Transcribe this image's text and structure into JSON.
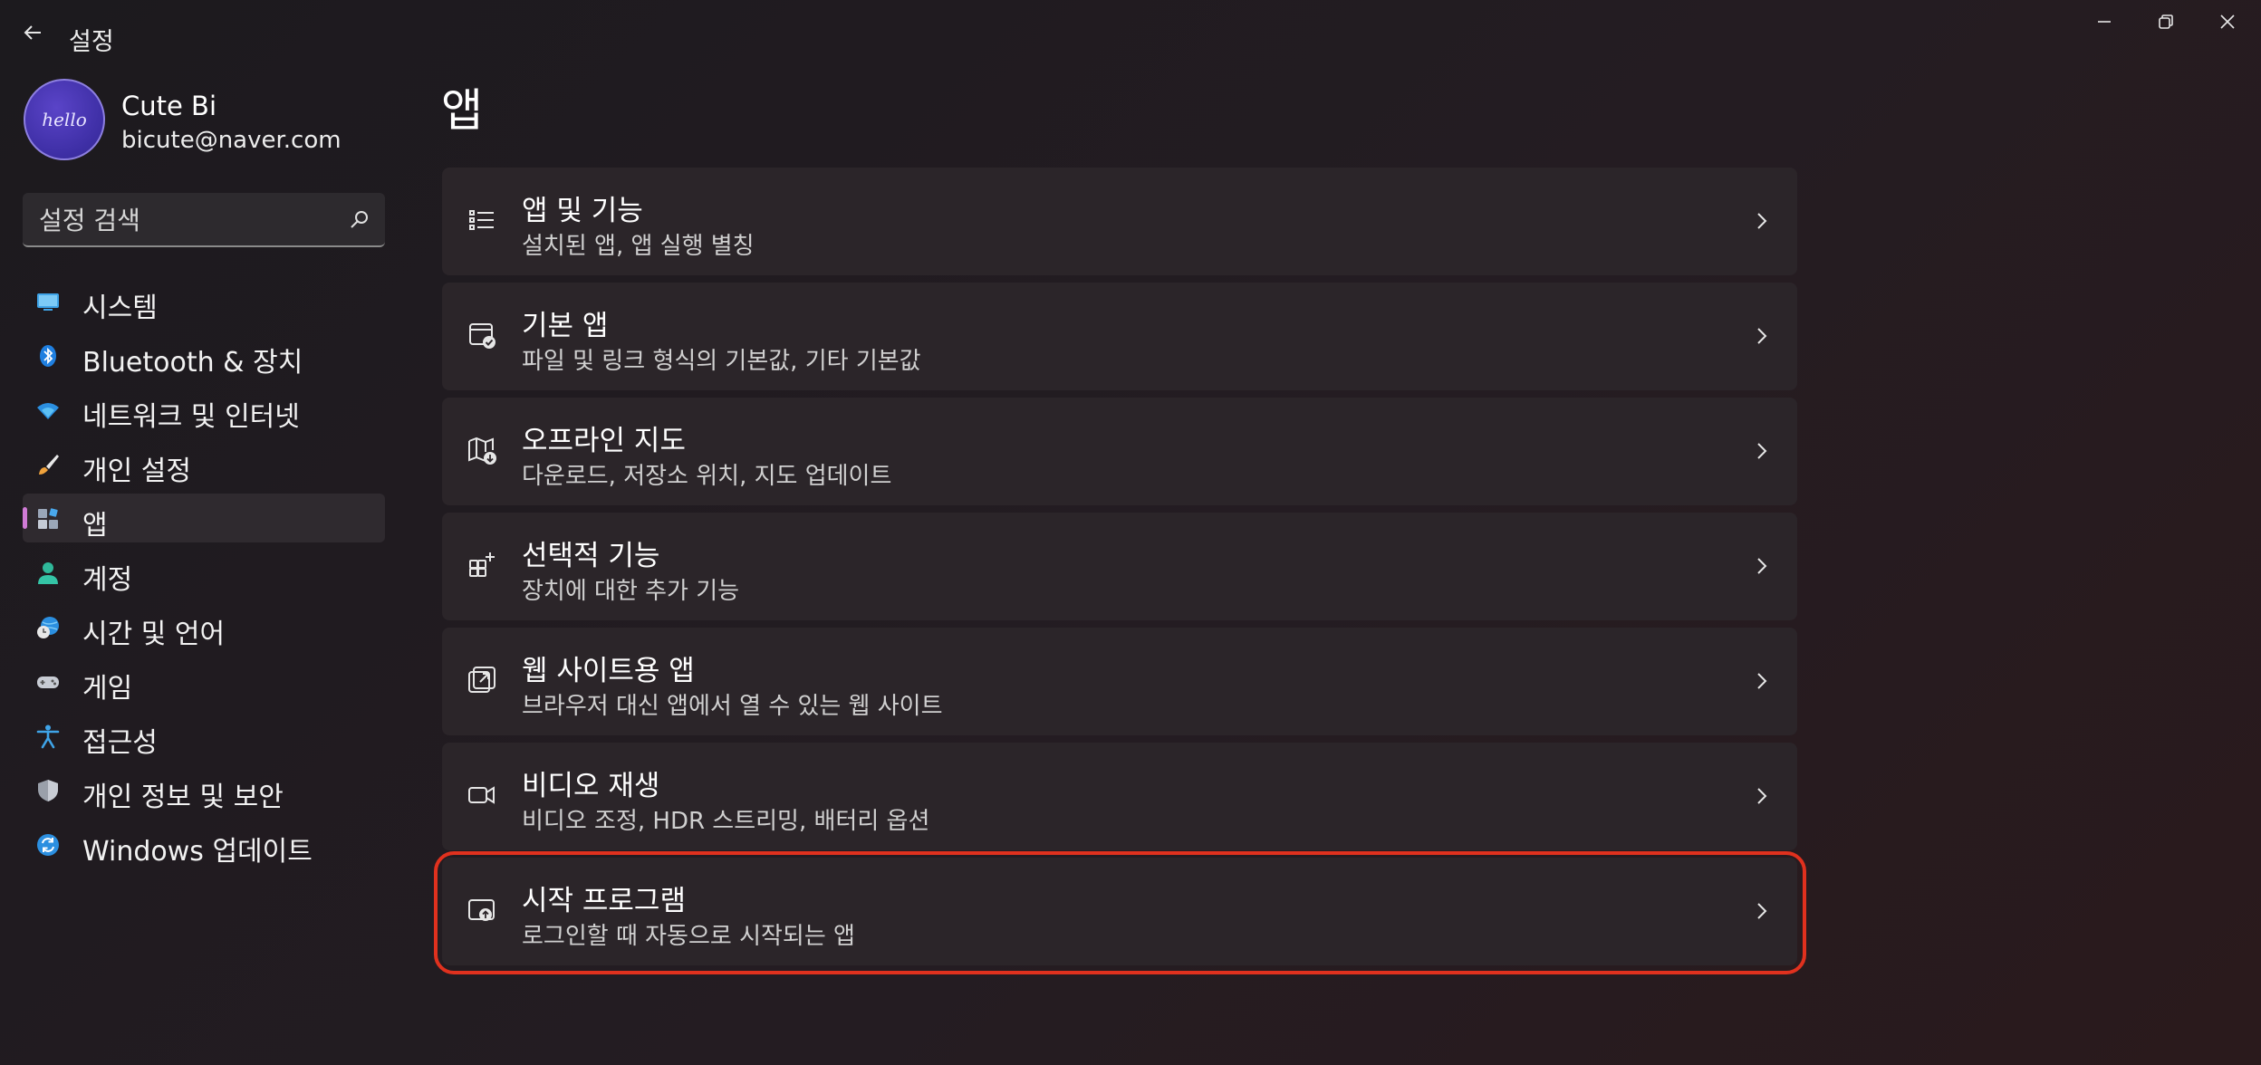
{
  "window": {
    "title": "설정"
  },
  "profile": {
    "name": "Cute Bi",
    "email": "bicute@naver.com",
    "avatar_text": "hello"
  },
  "search": {
    "placeholder": "설정 검색"
  },
  "nav": {
    "items": [
      {
        "label": "시스템",
        "icon": "monitor-icon"
      },
      {
        "label": "Bluetooth & 장치",
        "icon": "bluetooth-icon"
      },
      {
        "label": "네트워크 및 인터넷",
        "icon": "wifi-icon"
      },
      {
        "label": "개인 설정",
        "icon": "brush-icon"
      },
      {
        "label": "앱",
        "icon": "apps-icon",
        "selected": true
      },
      {
        "label": "계정",
        "icon": "person-icon"
      },
      {
        "label": "시간 및 언어",
        "icon": "globe-clock-icon"
      },
      {
        "label": "게임",
        "icon": "gamepad-icon"
      },
      {
        "label": "접근성",
        "icon": "accessibility-icon"
      },
      {
        "label": "개인 정보 및 보안",
        "icon": "shield-icon"
      },
      {
        "label": "Windows 업데이트",
        "icon": "update-icon"
      }
    ]
  },
  "main": {
    "title": "앱",
    "cards": [
      {
        "title": "앱 및 기능",
        "subtitle": "설치된 앱, 앱 실행 별칭",
        "icon": "list-icon"
      },
      {
        "title": "기본 앱",
        "subtitle": "파일 및 링크 형식의 기본값, 기타 기본값",
        "icon": "default-apps-icon"
      },
      {
        "title": "오프라인 지도",
        "subtitle": "다운로드, 저장소 위치, 지도 업데이트",
        "icon": "map-download-icon"
      },
      {
        "title": "선택적 기능",
        "subtitle": "장치에 대한 추가 기능",
        "icon": "add-features-icon"
      },
      {
        "title": "웹 사이트용 앱",
        "subtitle": "브라우저 대신 앱에서 열 수 있는 웹 사이트",
        "icon": "open-external-icon"
      },
      {
        "title": "비디오 재생",
        "subtitle": "비디오 조정, HDR 스트리밍, 배터리 옵션",
        "icon": "video-camera-icon"
      },
      {
        "title": "시작 프로그램",
        "subtitle": "로그인할 때 자동으로 시작되는 앱",
        "icon": "startup-icon",
        "highlighted": true
      }
    ]
  },
  "colors": {
    "accent": "#d07bd6",
    "highlight": "#e0311e",
    "card": "#2b2529"
  }
}
